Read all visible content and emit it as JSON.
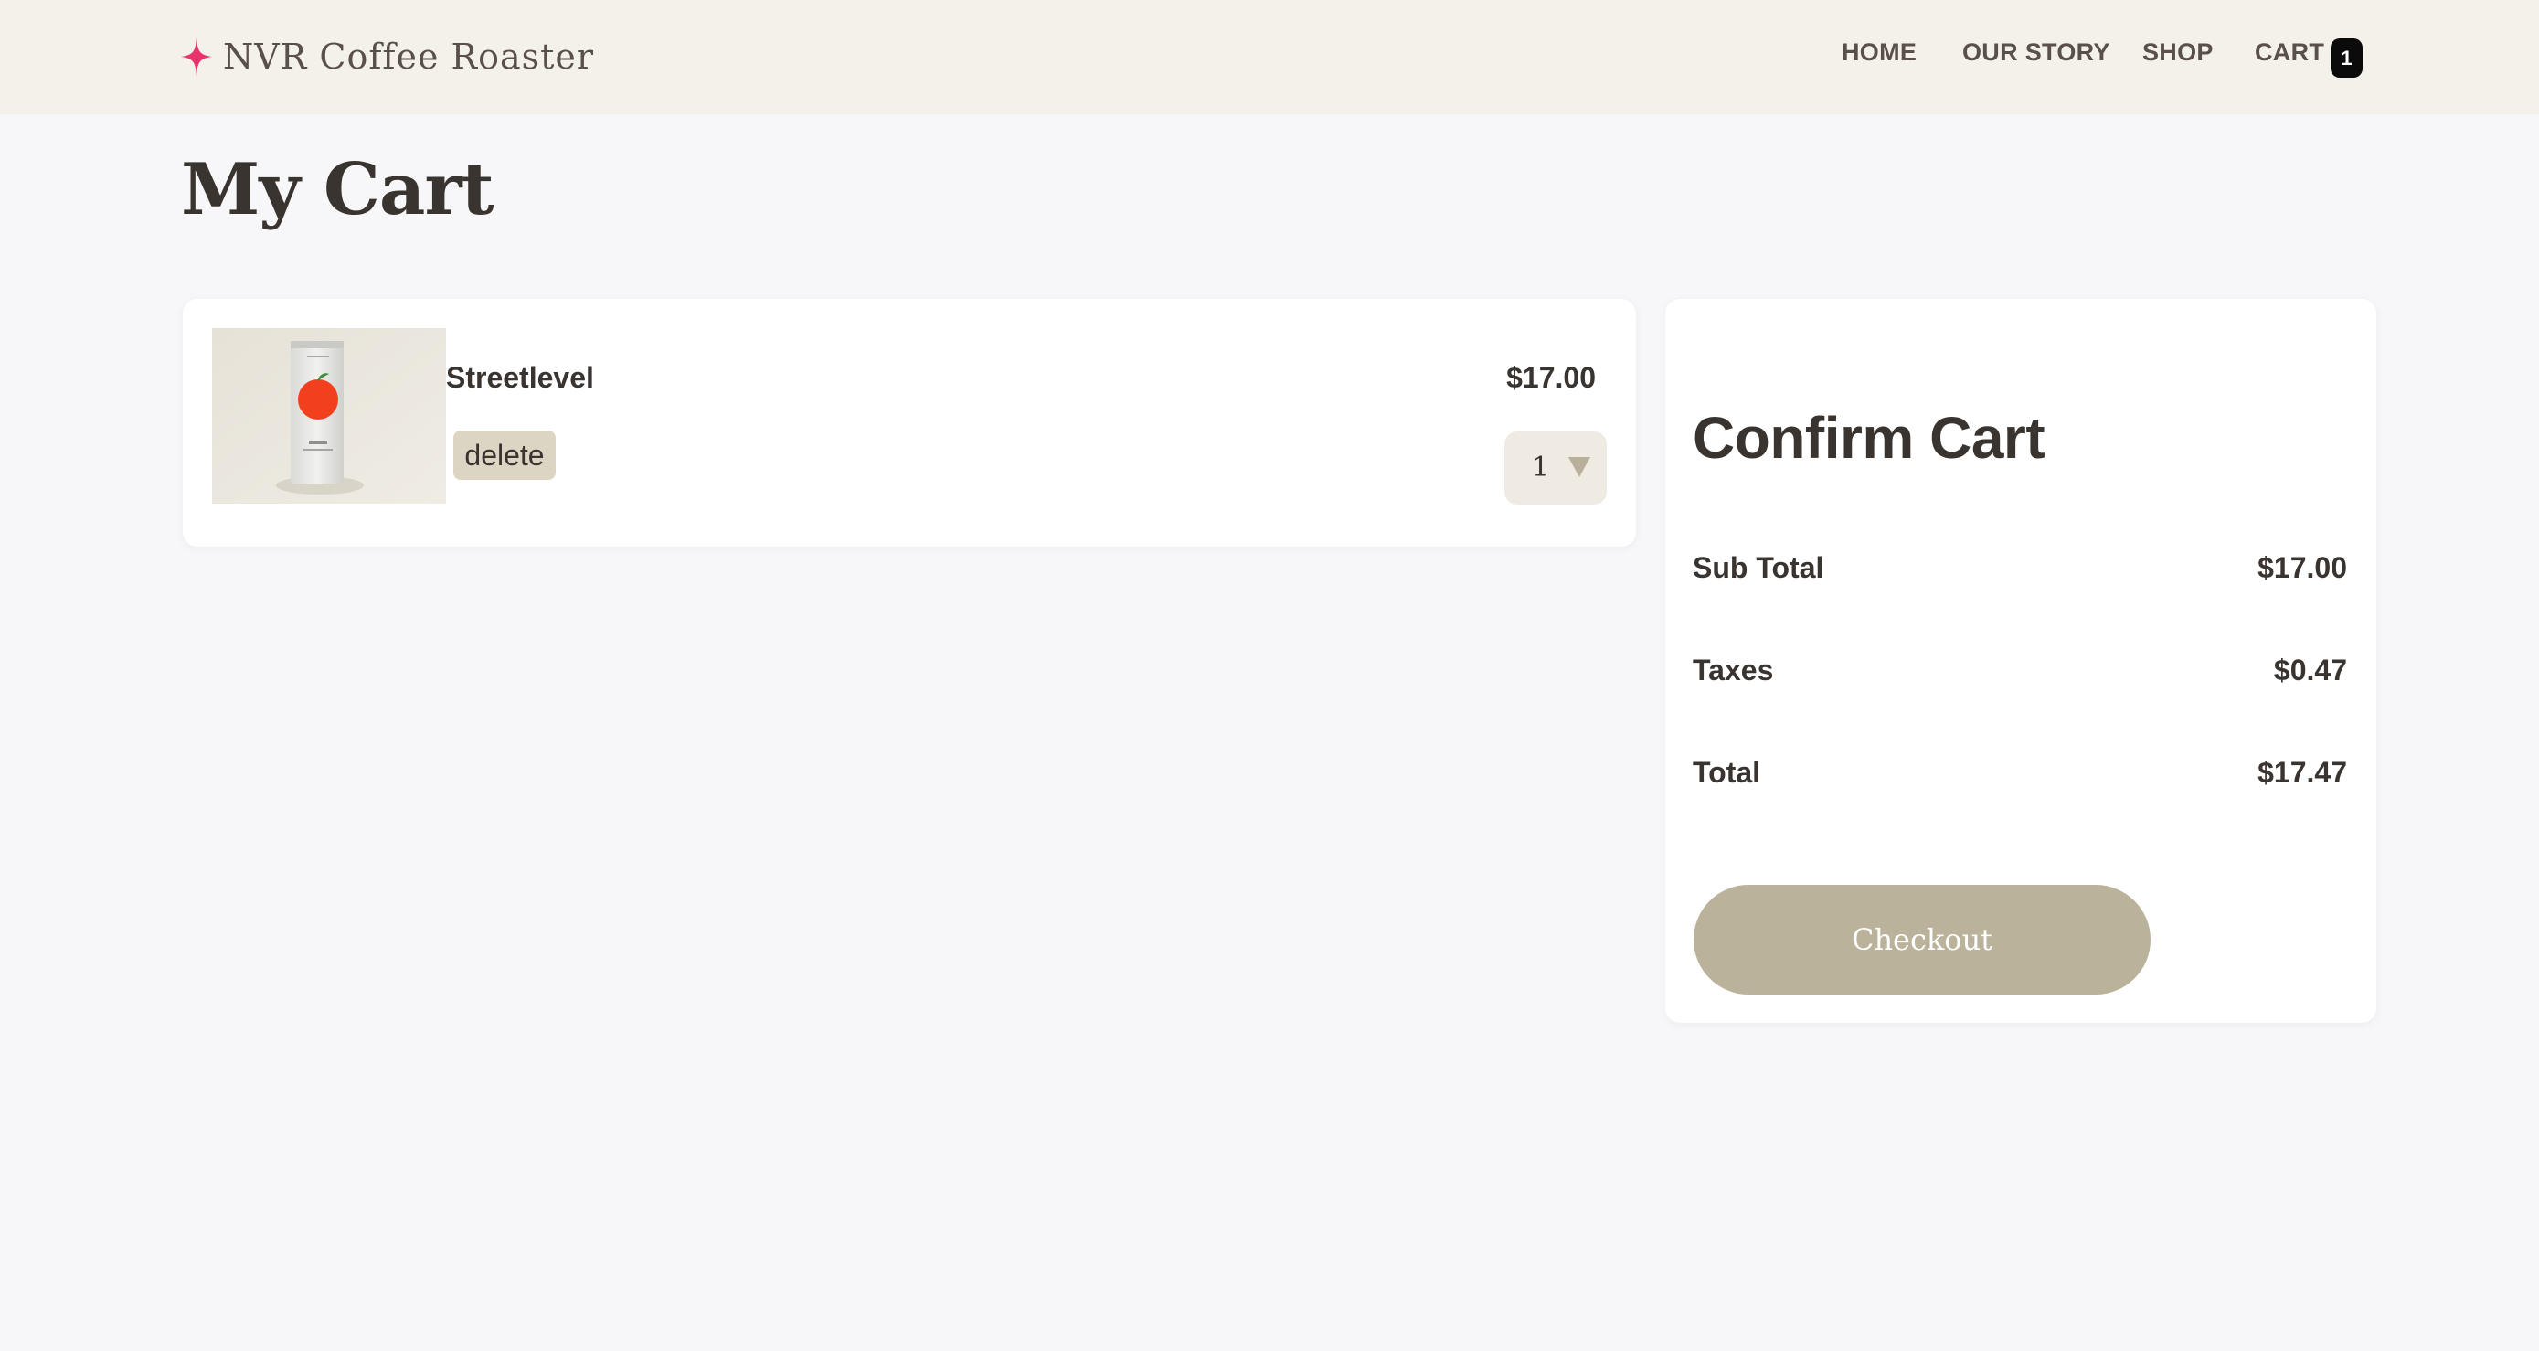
{
  "header": {
    "brand_name": "NVR Coffee Roaster",
    "brand_icon": "sparkle-star-icon",
    "brand_icon_color": "#e8336d",
    "nav": {
      "home": "HOME",
      "our_story": "OUR STORY",
      "shop": "SHOP",
      "cart": "CART",
      "cart_count": "1"
    }
  },
  "page": {
    "title": "My Cart"
  },
  "cart": {
    "items": [
      {
        "name": "Streetlevel",
        "price": "$17.00",
        "delete_label": "delete",
        "quantity": "1",
        "image": "coffee-bag-apple-image"
      }
    ]
  },
  "summary": {
    "title": "Confirm Cart",
    "subtotal_label": "Sub Total",
    "subtotal_value": "$17.00",
    "taxes_label": "Taxes",
    "taxes_value": "$0.47",
    "total_label": "Total",
    "total_value": "$17.47",
    "checkout_label": "Checkout"
  },
  "colors": {
    "header_bg": "#f4f1ea",
    "page_bg": "#f7f7f9",
    "accent": "#bab29a",
    "badge": "#0b0b0b",
    "text": "#3a3430"
  }
}
